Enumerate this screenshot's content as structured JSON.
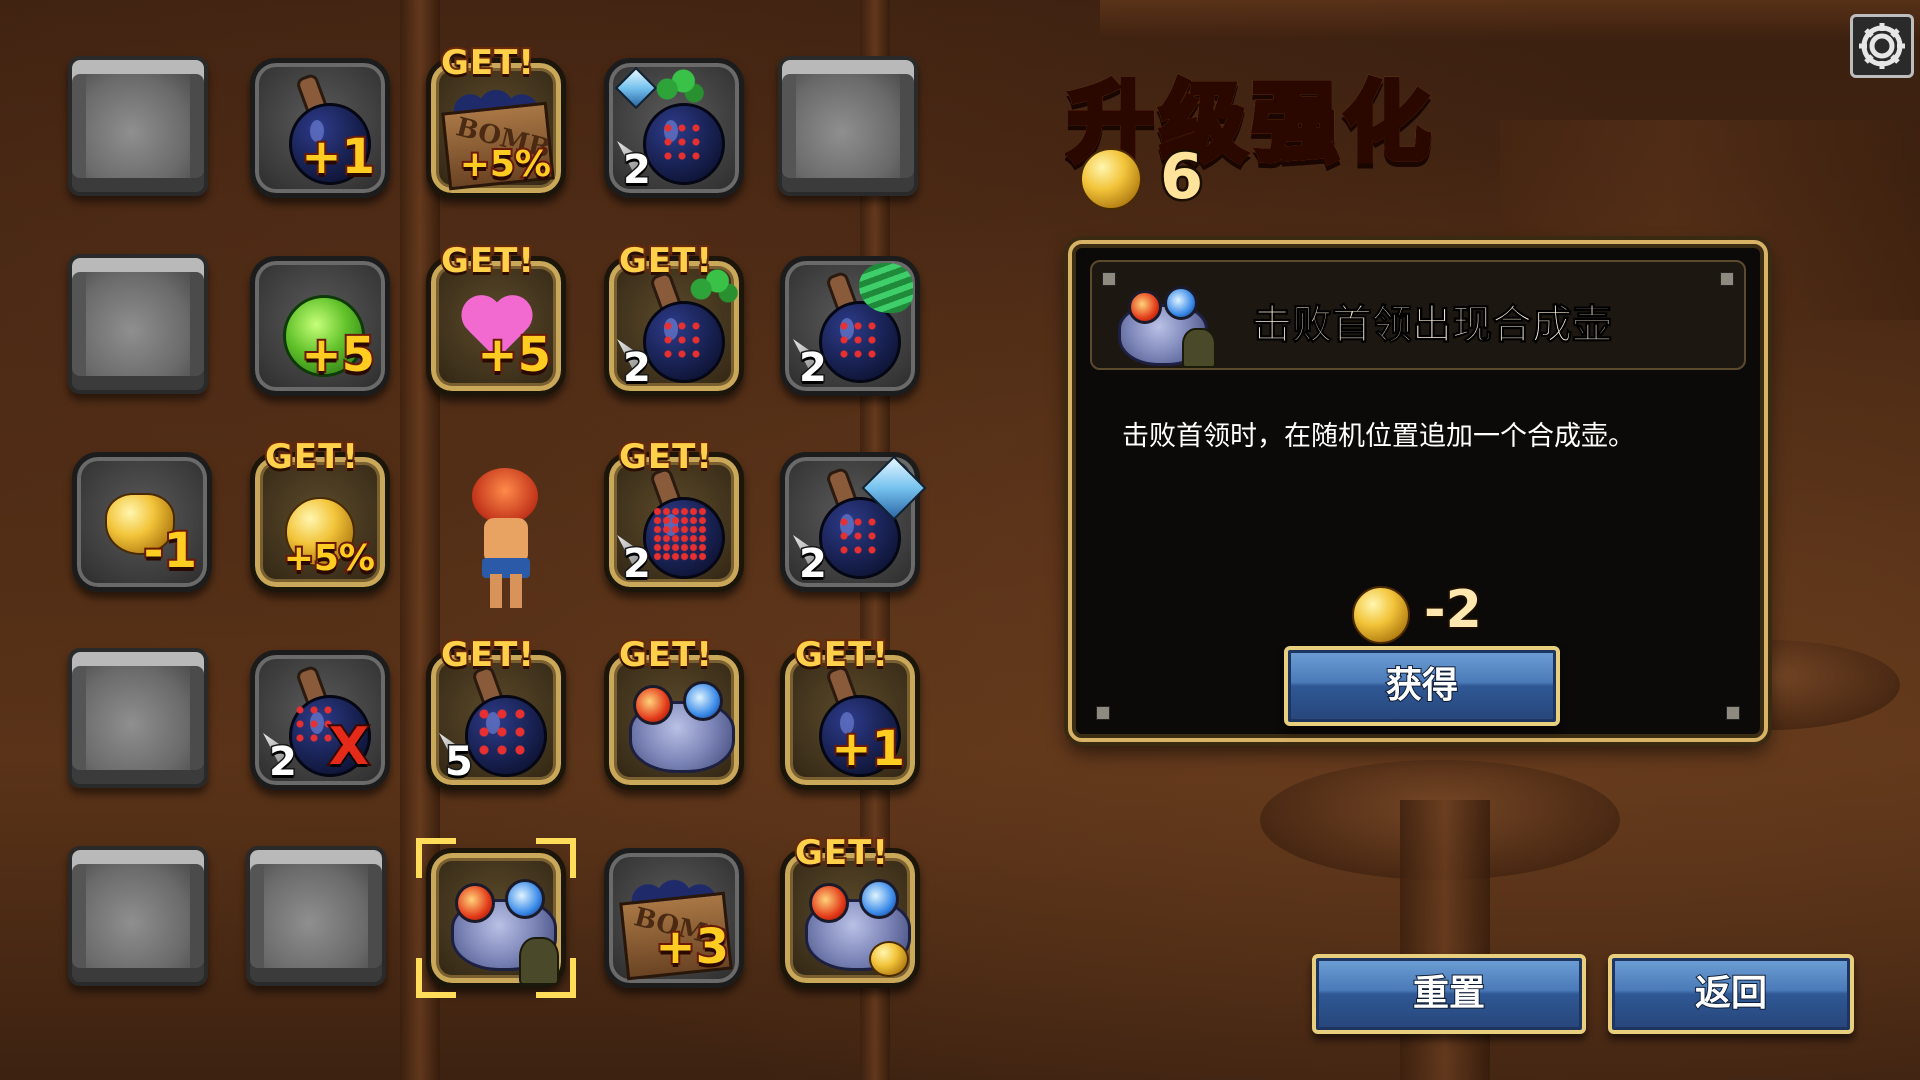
{
  "screen": {
    "title": "升级强化",
    "currency": "6"
  },
  "grid": {
    "get_label": "GET!",
    "tiles": [
      {
        "id": "r1c2",
        "bonus": "+1"
      },
      {
        "id": "r1c3",
        "bonus": "+5%"
      },
      {
        "id": "r1c4",
        "count": "2"
      },
      {
        "id": "r2c2",
        "bonus": "+5"
      },
      {
        "id": "r2c3",
        "bonus": "+5"
      },
      {
        "id": "r2c4",
        "count": "2"
      },
      {
        "id": "r2c5",
        "count": "2"
      },
      {
        "id": "r3c1",
        "bonus": "-1"
      },
      {
        "id": "r3c2",
        "bonus": "+5%"
      },
      {
        "id": "r3c4",
        "count": "2"
      },
      {
        "id": "r3c5",
        "count": "2"
      },
      {
        "id": "r4c2",
        "count": "2",
        "mark": "X"
      },
      {
        "id": "r4c3",
        "count": "5"
      },
      {
        "id": "r4c5",
        "bonus": "+1"
      },
      {
        "id": "r5c4",
        "bonus": "+3"
      }
    ]
  },
  "panel": {
    "title": "击败首领出现合成壶",
    "description": "击败首领时，在随机位置追加一个合成壶。",
    "cost": "-2",
    "obtain_label": "获得"
  },
  "footer": {
    "reset_label": "重置",
    "back_label": "返回"
  },
  "icons": {
    "settings": "gear-icon",
    "coin": "gold-coin-icon"
  },
  "colors": {
    "accent_gold": "#d8b265",
    "button_blue": "#4a7ab7",
    "title_orange": "#ff9a1a"
  }
}
